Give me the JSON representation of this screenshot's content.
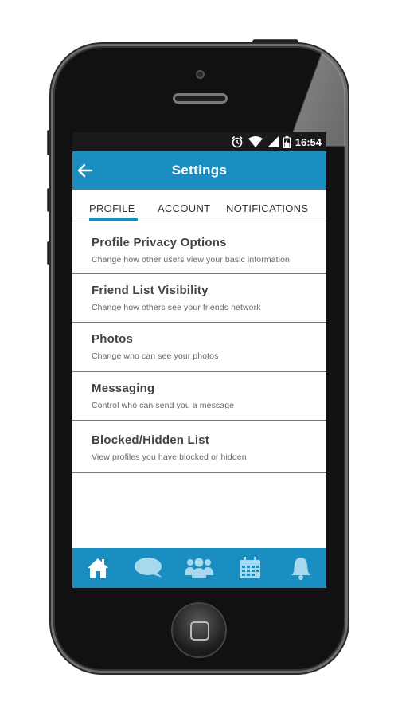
{
  "status": {
    "time": "16:54"
  },
  "header": {
    "title": "Settings"
  },
  "tabs": [
    {
      "label": "PROFILE",
      "active": true
    },
    {
      "label": "ACCOUNT",
      "active": false
    },
    {
      "label": "NOTIFICATIONS",
      "active": false
    }
  ],
  "settings": [
    {
      "title": "Profile Privacy Options",
      "subtitle": "Change how other users view your basic information"
    },
    {
      "title": "Friend List Visibility",
      "subtitle": "Change how others see your friends network"
    },
    {
      "title": "Photos",
      "subtitle": "Change who can see your photos"
    },
    {
      "title": "Messaging",
      "subtitle": "Control who can send you a message"
    },
    {
      "title": "Blocked/Hidden List",
      "subtitle": "View profiles you have blocked or hidden"
    }
  ],
  "bottom_nav": [
    "home-icon",
    "chat-icon",
    "friends-icon",
    "calendar-icon",
    "bell-icon"
  ],
  "colors": {
    "accent": "#1a8ec0",
    "status_bar": "#1a1a1a"
  }
}
